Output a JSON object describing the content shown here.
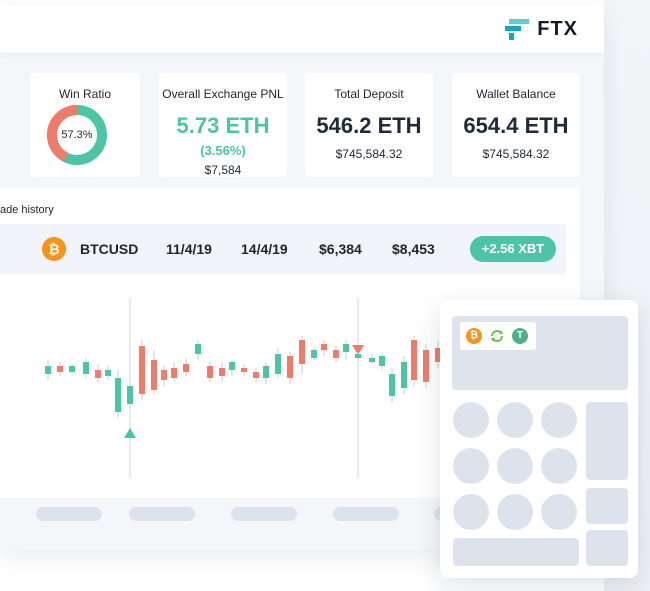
{
  "brand": {
    "name": "FTX"
  },
  "colors": {
    "green": "#4cc4a6",
    "red": "#ef7c6a",
    "bitcoin": "#f7931a",
    "tether": "#4cb08f",
    "panel_bg": "#f4f6fa"
  },
  "stats": {
    "win_ratio": {
      "title": "Win Ratio",
      "value": "57.3%",
      "fraction": 0.573
    },
    "exchange_pnl": {
      "title": "Overall Exchange PNL",
      "eth": "5.73 ETH",
      "pct": "(3.56%)",
      "usd": "$7,584"
    },
    "total_deposit": {
      "title": "Total Deposit",
      "eth": "546.2 ETH",
      "usd": "$745,584.32"
    },
    "wallet_balance": {
      "title": "Wallet Balance",
      "eth": "654.4 ETH",
      "usd": "$745,584.32"
    }
  },
  "trade_history": {
    "title": "ade history",
    "row": {
      "icon": "bitcoin-icon",
      "pair": "BTCUSD",
      "open_date": "11/4/19",
      "close_date": "14/4/19",
      "entry_price": "$6,384",
      "exit_price": "$8,453",
      "pnl": "+2.56 XBT"
    }
  },
  "converter": {
    "coins": [
      "bitcoin-icon",
      "swap-icon",
      "tether-icon"
    ]
  }
}
